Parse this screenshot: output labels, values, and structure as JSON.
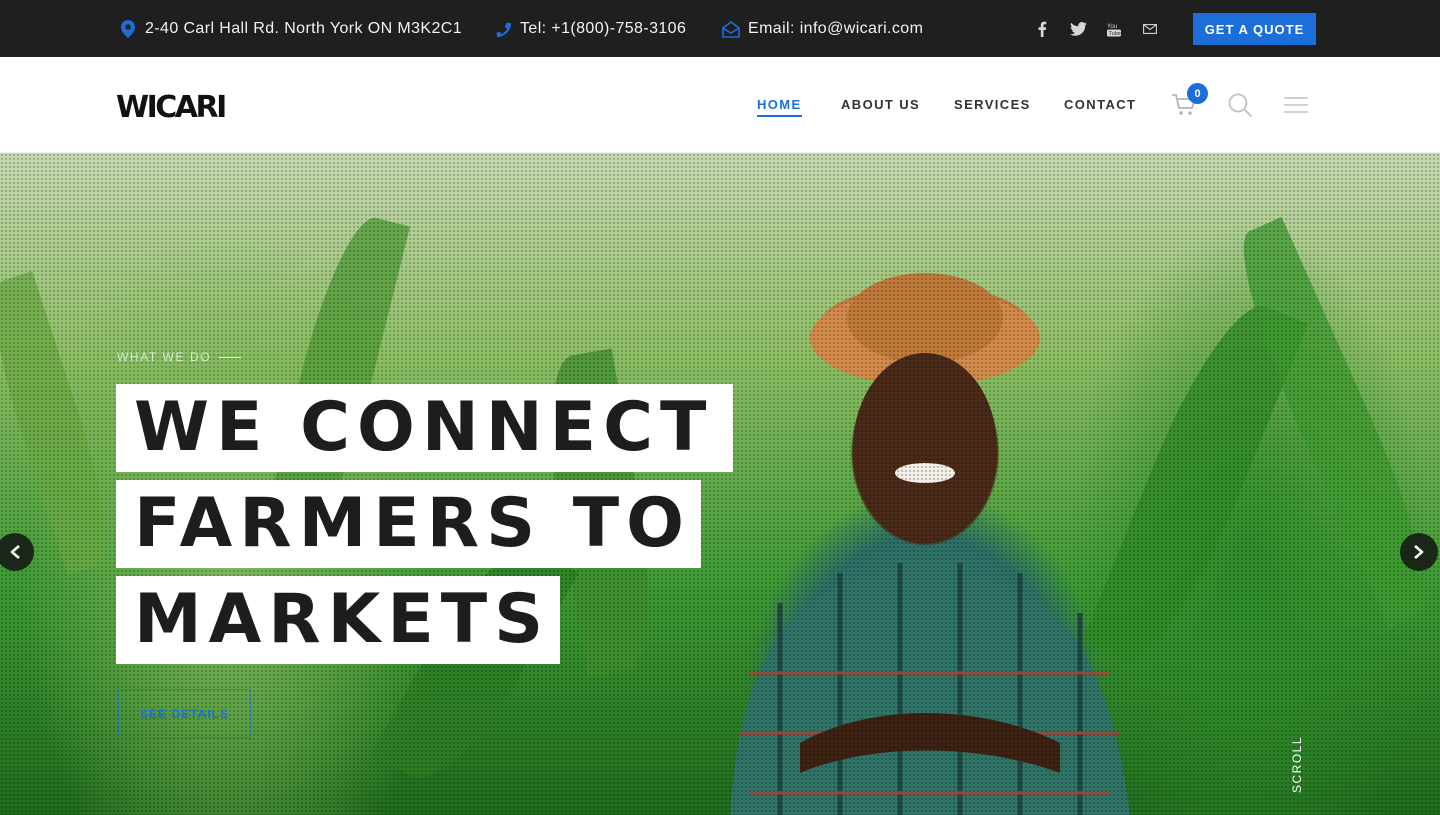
{
  "topbar": {
    "address": "2-40 Carl Hall  Rd. North York ON M3K2C1",
    "phone": "Tel: +1(800)-758-3106",
    "email": "Email: info@wicari.com",
    "social_icons": [
      "facebook-icon",
      "twitter-icon",
      "youtube-icon",
      "mail-icon"
    ],
    "quote_label": "GET A QUOTE"
  },
  "header": {
    "logo_text": "WICARI",
    "nav": [
      {
        "label": "HOME",
        "active": true
      },
      {
        "label": "ABOUT US",
        "active": false
      },
      {
        "label": "SERVICES",
        "active": false
      },
      {
        "label": "CONTACT",
        "active": false
      }
    ],
    "cart_count": "0",
    "icons": [
      "cart-icon",
      "search-icon",
      "menu-icon"
    ]
  },
  "hero": {
    "eyebrow": "WHAT WE DO",
    "headline_lines": [
      "WE CONNECT",
      "FARMERS TO",
      "MARKETS"
    ],
    "button_label": "SEE DETAILS",
    "scroll_label": "SCROLL",
    "nav_icons": [
      "arrow-left-icon",
      "arrow-right-icon"
    ]
  },
  "colors": {
    "accent": "#1c6ed8",
    "topbar_bg": "#1f1f1f",
    "text_dark": "#1d1d1d"
  }
}
